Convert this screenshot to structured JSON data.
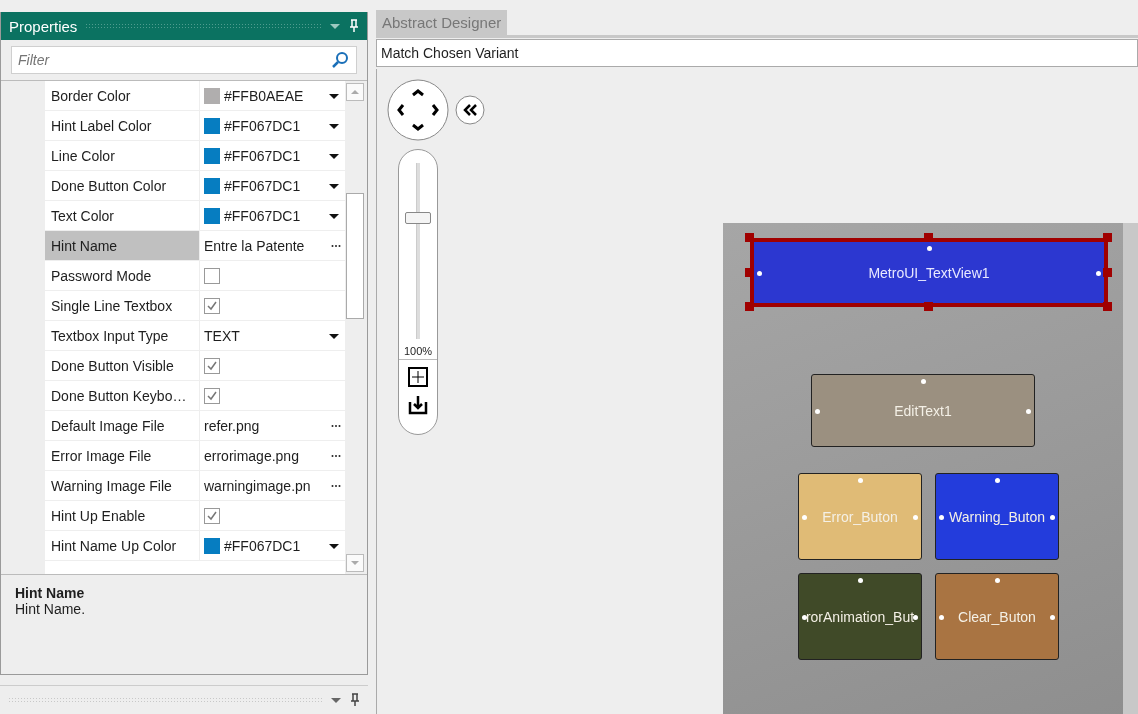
{
  "properties_panel": {
    "title": "Properties",
    "filter": {
      "placeholder": "Filter"
    },
    "rows": [
      {
        "label": "Border Color",
        "kind": "color",
        "value": "#FFB0AEAE",
        "color": "#b0aeae",
        "selected": false
      },
      {
        "label": "Hint Label Color",
        "kind": "color",
        "value": "#FF067DC1",
        "color": "#067dc1",
        "selected": false
      },
      {
        "label": "Line Color",
        "kind": "color",
        "value": "#FF067DC1",
        "color": "#067dc1",
        "selected": false
      },
      {
        "label": "Done Button Color",
        "kind": "color",
        "value": "#FF067DC1",
        "color": "#067dc1",
        "selected": false
      },
      {
        "label": "Text Color",
        "kind": "color",
        "value": "#FF067DC1",
        "color": "#067dc1",
        "selected": false
      },
      {
        "label": "Hint Name",
        "kind": "text",
        "value": "Entre la Patente",
        "selected": true
      },
      {
        "label": "Password Mode",
        "kind": "check",
        "checked": false,
        "selected": false
      },
      {
        "label": "Single Line Textbox",
        "kind": "check",
        "checked": true,
        "selected": false
      },
      {
        "label": "Textbox Input Type",
        "kind": "enum",
        "value": "TEXT",
        "selected": false
      },
      {
        "label": "Done Button Visible",
        "kind": "check",
        "checked": true,
        "selected": false
      },
      {
        "label": "Done Button Keybo…",
        "kind": "check",
        "checked": true,
        "selected": false
      },
      {
        "label": "Default Image File",
        "kind": "text",
        "value": "refer.png",
        "selected": false
      },
      {
        "label": "Error Image File",
        "kind": "text",
        "value": "errorimage.png",
        "selected": false
      },
      {
        "label": "Warning Image File",
        "kind": "text",
        "value": "warningimage.pn",
        "selected": false
      },
      {
        "label": "Hint Up Enable",
        "kind": "check",
        "checked": true,
        "selected": false
      },
      {
        "label": "Hint Name Up Color",
        "kind": "color",
        "value": "#FF067DC1",
        "color": "#067dc1",
        "selected": false
      }
    ],
    "description": {
      "title": "Hint Name",
      "text": "Hint Name."
    }
  },
  "designer": {
    "tab": {
      "label": "Abstract Designer",
      "selected": true
    },
    "variant": "Match Chosen Variant",
    "zoom": {
      "level": 0.69,
      "reading": "100%"
    },
    "widgets": [
      {
        "label": "MetroUI_TextView1",
        "color": "#2c37d0",
        "selected": true
      },
      {
        "label": "EditText1",
        "color": "#9b9080",
        "selected": false
      },
      {
        "label": "Error_Buton",
        "color": "#e0bb76",
        "selected": false
      },
      {
        "label": "Warning_Buton",
        "color": "#233cdc",
        "selected": false
      },
      {
        "label": "rorAnimation_But",
        "color": "#404a28",
        "selected": false
      },
      {
        "label": "Clear_Buton",
        "color": "#a97442",
        "selected": false
      }
    ]
  }
}
